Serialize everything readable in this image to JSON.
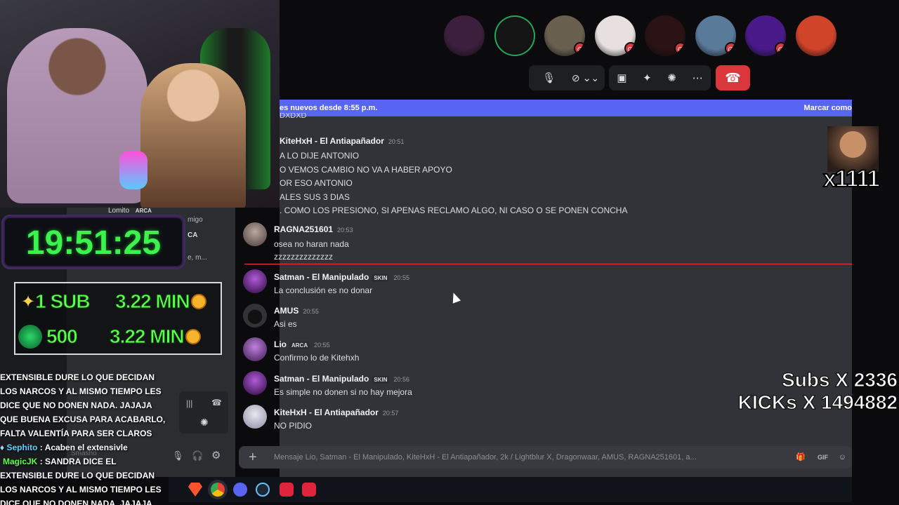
{
  "call": {
    "hangup_icon": "phone-hangup-icon",
    "participants": [
      {
        "name": "participant-1",
        "color": "#3b1f3d",
        "muted": false
      },
      {
        "name": "participant-2",
        "color": "#151515",
        "muted": false,
        "speaking": true
      },
      {
        "name": "participant-3",
        "color": "#6a6050",
        "muted": true
      },
      {
        "name": "participant-4",
        "color": "#e8e0e0",
        "muted": true
      },
      {
        "name": "participant-5",
        "color": "#2b1214",
        "muted": true
      },
      {
        "name": "participant-6",
        "color": "#5a7a9a",
        "muted": true
      },
      {
        "name": "participant-7",
        "color": "#4a1a8a",
        "muted": true
      },
      {
        "name": "participant-8",
        "color": "#d0442a",
        "muted": false
      }
    ]
  },
  "chat": {
    "new_messages_banner": "es nuevos desde 8:55 p.m.",
    "mark_read": "Marcar como",
    "cut_top": "DXDXD",
    "messages": [
      {
        "author": "KiteHxH - El Antiapañador",
        "time": "20:51",
        "lines": [
          "A LO DIJE ANTONIO",
          "O VEMOS CAMBIO NO VA A HABER APOYO",
          "OR ESO ANTONIO",
          "ALES SUS 3 DIAS",
          ". COMO LOS PRESIONO, SI APENAS RECLAMO ALGO, NI CASO O SE PONEN CONCHA"
        ]
      },
      {
        "author": "RAGNA251601",
        "time": "20:53",
        "lines": [
          "osea no haran nada",
          "zzzzzzzzzzzzzz"
        ]
      },
      {
        "author": "Satman - El Manipulado",
        "tag": "SKIN",
        "time": "20:55",
        "lines": [
          "La conclusión es no donar"
        ]
      },
      {
        "author": "AMUS",
        "time": "20:55",
        "lines": [
          "Asi es"
        ]
      },
      {
        "author": "Lio",
        "tag": "ARCA",
        "time": "20:55",
        "lines": [
          "Confirmo lo de Kitehxh"
        ]
      },
      {
        "author": "Satman - El Manipulado",
        "tag": "SKIN",
        "time": "20:56",
        "lines": [
          "Es simple no donen si no hay mejora"
        ]
      },
      {
        "author": "KiteHxH - El Antiapañador",
        "time": "20:57",
        "lines": [
          "NO PIDIO"
        ]
      }
    ],
    "composer_placeholder": "Mensaje Lio, Satman - El Manipulado, KiteHxH - El Antiapañador, 2k / Lightblur X, Dragonwaar, AMUS, RAGNA251601, a..."
  },
  "side": {
    "user_lomito": "Lomito",
    "tag_arca": "ARCA",
    "side_snippets": [
      "migo",
      "CA",
      "e, m...",
      "Smasho"
    ]
  },
  "overlay": {
    "timer": "19:51:25",
    "goal1_left": "1 SUB",
    "goal1_right": "3.22 MIN",
    "goal2_left": "500",
    "goal2_right": "3.22 MIN",
    "chat_lines": [
      {
        "user": "",
        "text": "EXTENSIBLE DURE LO QUE DECIDAN LOS NARCOS Y AL MISMO TIEMPO LES DICE QUE NO DONEN NADA. JAJAJA QUE BUENA EXCUSA PARA ACABARLO, FALTA VALENTÍA PARA SER CLAROS"
      },
      {
        "user": "Sephito",
        "user_color": "#5ad1ff",
        "text": "Acaben el extensivle"
      },
      {
        "user": "MagicJK",
        "user_color": "#5cff4a",
        "text": "SANDRA DICE EL EXTENSIBLE DURE LO QUE DECIDAN LOS NARCOS Y AL MISMO TIEMPO LES DICE QUE NO DONEN NADA. JAJAJA QUE"
      }
    ],
    "meme_text": "x1111",
    "subs_label": "Subs X 2336",
    "kicks_label": "KICKs X 1494882"
  }
}
